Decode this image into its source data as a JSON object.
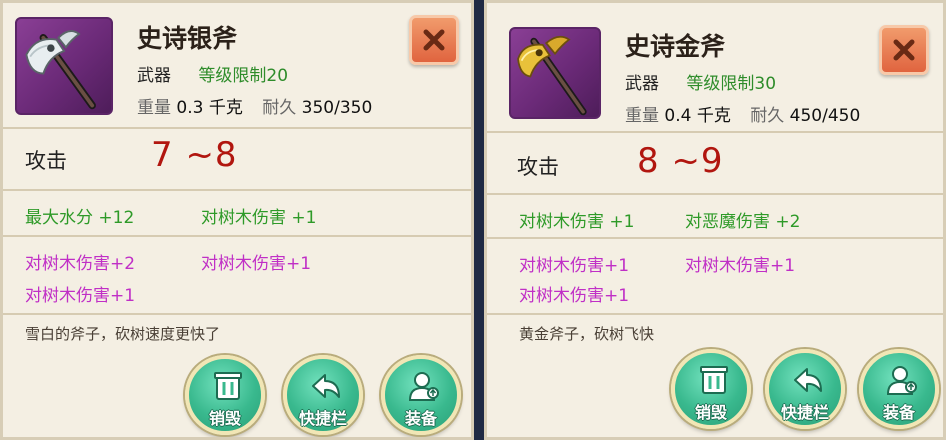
{
  "panels": [
    {
      "title": "史诗银斧",
      "type": "武器",
      "level_req": "等级限制20",
      "weight_label": "重量",
      "weight": "0.3 千克",
      "durability_label": "耐久",
      "durability": "350/350",
      "attack_label": "攻击",
      "attack": "7 ~8",
      "green_stats": [
        "最大水分 +12",
        "对树木伤害 +1"
      ],
      "magenta_stats": [
        "对树木伤害+2",
        "对树木伤害+1",
        "对树木伤害+1"
      ],
      "description": "雪白的斧子，砍树速度更快了",
      "icon": "silver-axe-icon",
      "buttons": {
        "destroy": "销毁",
        "shortcut": "快捷栏",
        "equip": "装备"
      }
    },
    {
      "title": "史诗金斧",
      "type": "武器",
      "level_req": "等级限制30",
      "weight_label": "重量",
      "weight": "0.4 千克",
      "durability_label": "耐久",
      "durability": "450/450",
      "attack_label": "攻击",
      "attack": "8 ~9",
      "green_stats": [
        "对树木伤害 +1",
        "对恶魔伤害 +2"
      ],
      "magenta_stats": [
        "对树木伤害+1",
        "对树木伤害+1",
        "对树木伤害+1"
      ],
      "description": "黄金斧子，砍树飞快",
      "icon": "golden-axe-icon",
      "buttons": {
        "destroy": "销毁",
        "shortcut": "快捷栏",
        "equip": "装备"
      }
    }
  ],
  "colors": {
    "panel_bg": "#f4efe3",
    "attack_value": "#b1160f",
    "green_stat": "#2e9a28",
    "magenta_stat": "#c02fc6",
    "button_green": "#39b98e",
    "close_orange": "#e0643f",
    "item_bg_purple": "#6b2a78"
  }
}
